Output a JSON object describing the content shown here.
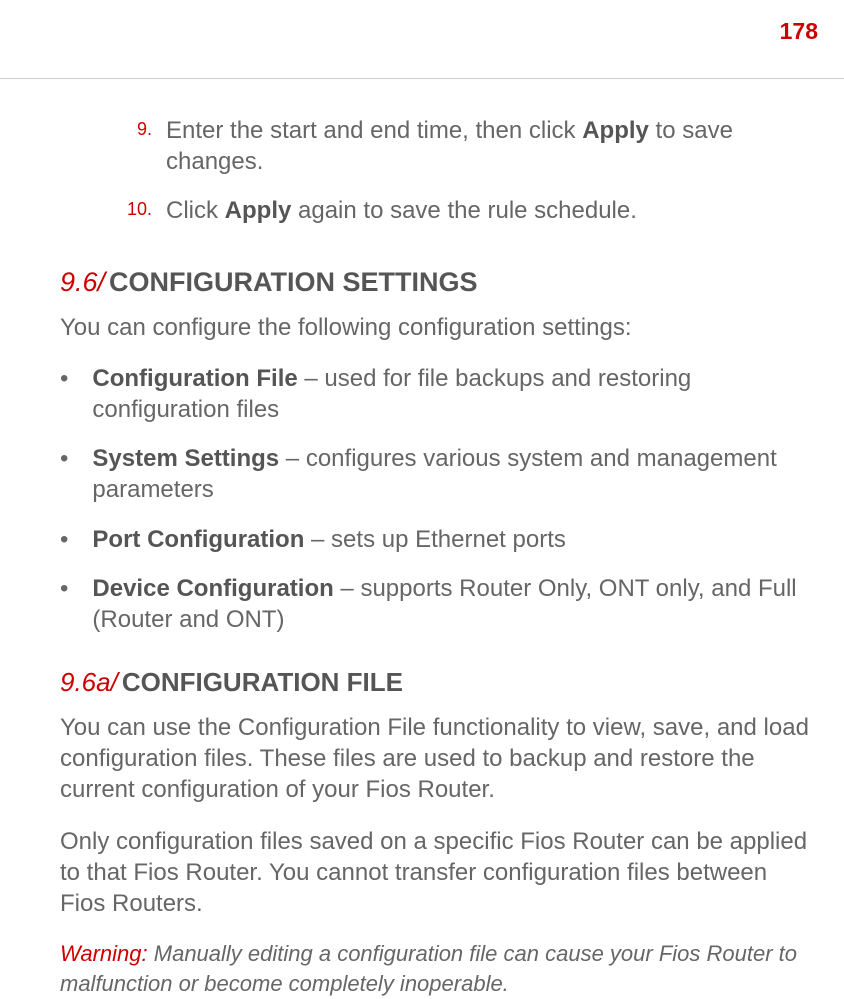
{
  "page_number": "178",
  "step9": {
    "num": "9.",
    "text_before": "Enter the start and end time, then click ",
    "bold": "Apply",
    "text_after": " to save changes."
  },
  "step10": {
    "num": "10.",
    "text_before": "Click ",
    "bold": "Apply",
    "text_after": " again to save the rule schedule."
  },
  "section96": {
    "num": "9.6/",
    "title": "CONFIGURATION SETTINGS"
  },
  "section96_intro": "You can configure the following configuration settings:",
  "bullets": [
    {
      "bold": "Configuration File",
      "text": " – used for file backups and restoring configuration files"
    },
    {
      "bold": "System Settings",
      "text": " – configures various system and management parameters"
    },
    {
      "bold": "Port Configuration",
      "text": " – sets up Ethernet ports"
    },
    {
      "bold": "Device Configuration",
      "text": " – supports Router Only, ONT only, and Full (Router and ONT)"
    }
  ],
  "section96a": {
    "num": "9.6a/",
    "title": "CONFIGURATION FILE"
  },
  "section96a_para1": "You can use the Configuration File functionality to view, save, and load configuration files. These files are used to backup and restore the current configuration of your Fios Router.",
  "section96a_para2": "Only configuration files saved on a specific Fios Router can be applied to that Fios Router. You cannot transfer configuration files between Fios Routers.",
  "warning": {
    "label": "Warning:",
    "text": " Manually editing a configuration file can cause your Fios Router to malfunction or become completely inoperable."
  }
}
